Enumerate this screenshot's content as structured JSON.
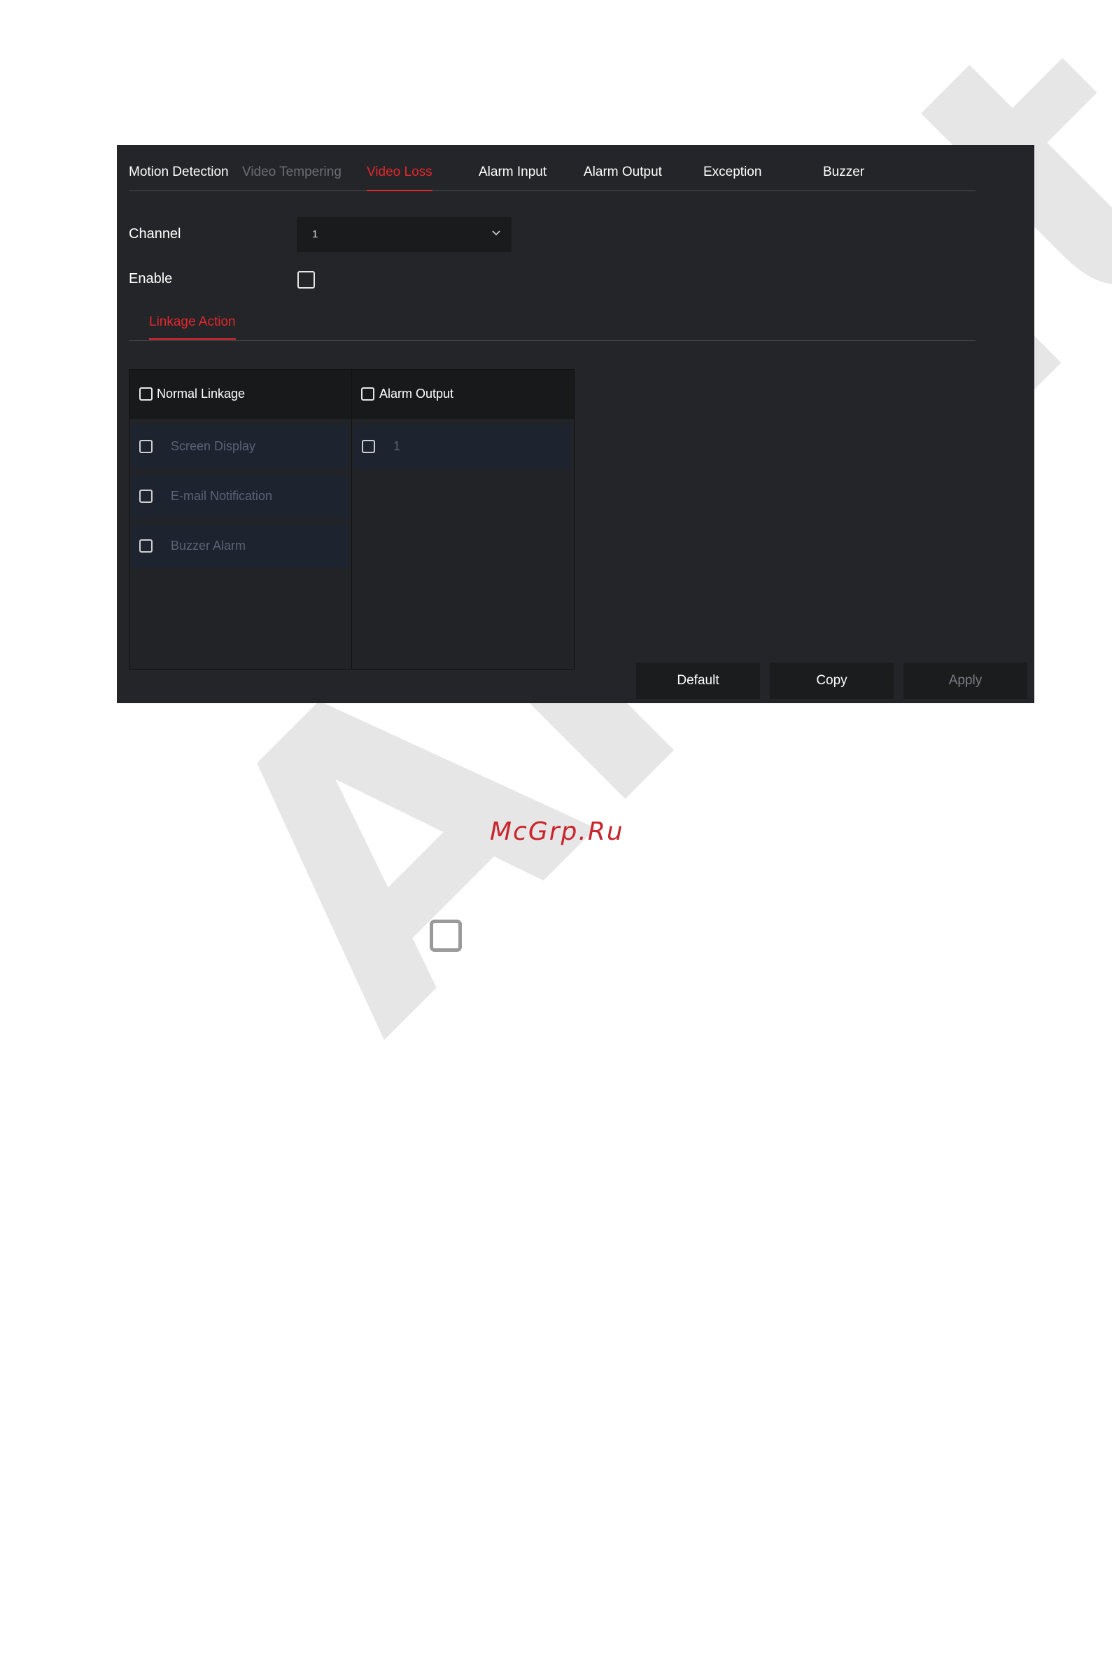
{
  "watermark": "Amat",
  "tabs": [
    {
      "label": "Motion Detection",
      "state": "normal"
    },
    {
      "label": "Video Tempering",
      "state": "disabled"
    },
    {
      "label": "Video Loss",
      "state": "active"
    },
    {
      "label": "Alarm Input",
      "state": "normal"
    },
    {
      "label": "Alarm Output",
      "state": "normal"
    },
    {
      "label": "Exception",
      "state": "normal"
    },
    {
      "label": "Buzzer",
      "state": "normal"
    }
  ],
  "form": {
    "channel_label": "Channel",
    "channel_value": "1",
    "enable_label": "Enable",
    "enable_checked": false
  },
  "linkage": {
    "subtab_label": "Linkage Action",
    "normal": {
      "header": "Normal Linkage",
      "items": [
        "Screen Display",
        "E-mail Notification",
        "Buzzer Alarm"
      ]
    },
    "alarm_output": {
      "header": "Alarm Output",
      "items": [
        "1"
      ]
    }
  },
  "buttons": {
    "default_label": "Default",
    "copy_label": "Copy",
    "apply_label": "Apply"
  },
  "footer": {
    "site_label": "McGrp.Ru"
  },
  "colors": {
    "accent": "#e3272d",
    "panel_bg": "#232528",
    "site_label": "#c8252c"
  },
  "icons": {
    "dropdown": "chevron-down-icon",
    "checkbox": "checkbox-icon"
  }
}
